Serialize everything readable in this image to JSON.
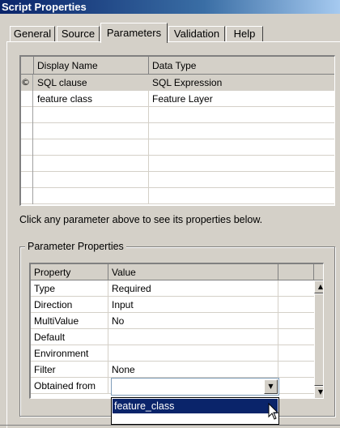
{
  "window": {
    "title": "Script Properties"
  },
  "tabs": [
    {
      "label": "General"
    },
    {
      "label": "Source"
    },
    {
      "label": "Parameters",
      "active": true
    },
    {
      "label": "Validation"
    },
    {
      "label": "Help"
    }
  ],
  "params_grid": {
    "columns": [
      "Display Name",
      "Data Type"
    ],
    "rows": [
      {
        "selected": true,
        "marker": "©",
        "name": "SQL clause",
        "type": "SQL Expression"
      },
      {
        "selected": false,
        "marker": "",
        "name": "feature class",
        "type": "Feature Layer"
      }
    ]
  },
  "hint": "Click any parameter above to see its properties below.",
  "properties": {
    "group_title": "Parameter Properties",
    "columns": [
      "Property",
      "Value"
    ],
    "rows": [
      {
        "property": "Type",
        "value": "Required"
      },
      {
        "property": "Direction",
        "value": "Input"
      },
      {
        "property": "MultiValue",
        "value": "No"
      },
      {
        "property": "Default",
        "value": ""
      },
      {
        "property": "Environment",
        "value": ""
      },
      {
        "property": "Filter",
        "value": "None"
      },
      {
        "property": "Obtained from",
        "value": ""
      }
    ]
  },
  "combo": {
    "value": "",
    "options": [
      "feature_class"
    ],
    "highlighted": "feature_class"
  },
  "colors": {
    "title_bar": "#0a246a",
    "selection": "#0a246a",
    "dialog_bg": "#d4d0c8"
  }
}
